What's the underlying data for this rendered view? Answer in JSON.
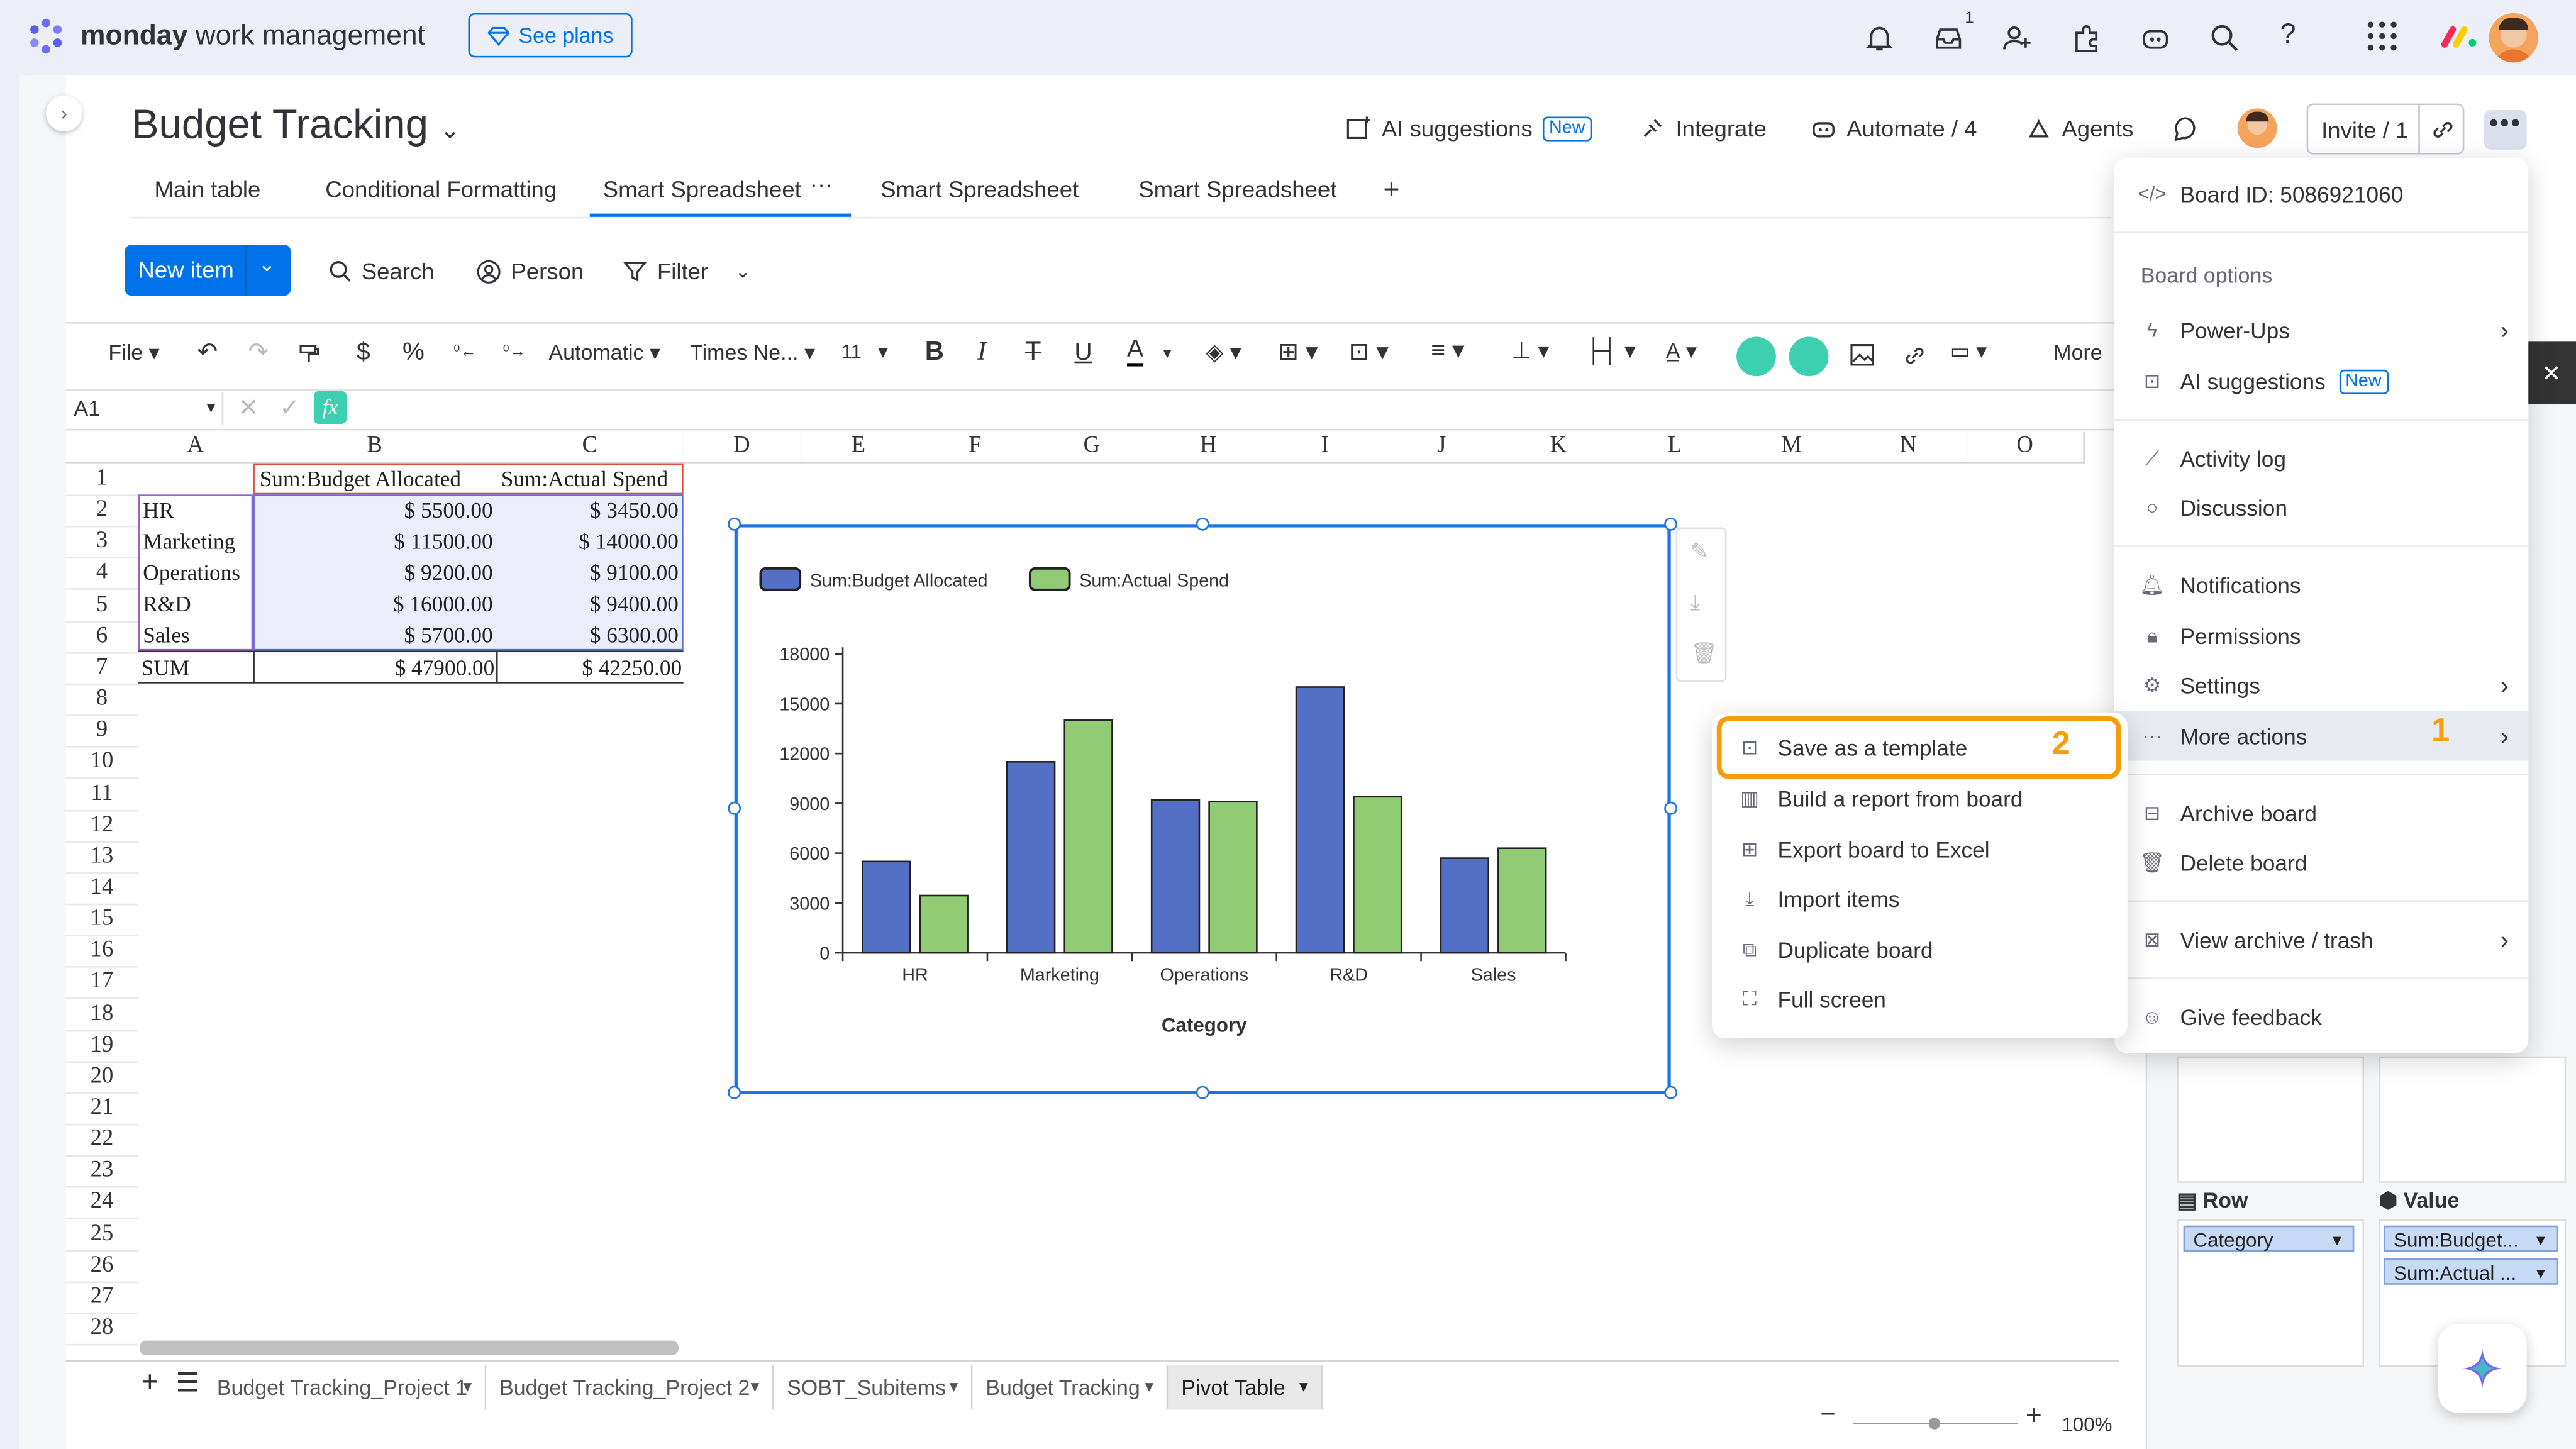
{
  "app": {
    "brand_bold": "monday",
    "brand_rest": " work management",
    "see_plans": "See plans",
    "inbox_count": "1"
  },
  "board": {
    "title": "Budget Tracking",
    "ai_suggestions": "AI suggestions",
    "new_badge": "New",
    "integrate": "Integrate",
    "automate": "Automate / 4",
    "agents": "Agents",
    "invite": "Invite / 1"
  },
  "tabs": [
    "Main table",
    "Conditional Formatting",
    "Smart Spreadsheet",
    "Smart Spreadsheet",
    "Smart Spreadsheet"
  ],
  "tab_add": "+",
  "tab_more": "···",
  "actions": {
    "new_item": "New item",
    "search": "Search",
    "person": "Person",
    "filter": "Filter"
  },
  "toolbar": {
    "file": "File",
    "currency": "$",
    "percent": "%",
    "format": "Automatic",
    "font": "Times Ne...",
    "size": "11",
    "bold": "B",
    "italic": "I",
    "strike": "T",
    "underline": "U",
    "fontcolor": "A",
    "more": "More"
  },
  "formula": {
    "cellref": "A1",
    "fx": "fx"
  },
  "columns": [
    "A",
    "B",
    "C",
    "D",
    "E",
    "F",
    "G",
    "H",
    "I",
    "J",
    "K",
    "L",
    "M",
    "N",
    "O"
  ],
  "rows": [
    "1",
    "2",
    "3",
    "4",
    "5",
    "6",
    "7",
    "8",
    "9",
    "10",
    "11",
    "12",
    "13",
    "14",
    "15",
    "16",
    "17",
    "18",
    "19",
    "20",
    "21",
    "22",
    "23",
    "24",
    "25",
    "26",
    "27",
    "28"
  ],
  "table": {
    "headers": [
      "Sum:Budget Allocated",
      "Sum:Actual Spend"
    ],
    "rows": [
      {
        "cat": "HR",
        "budget": "$ 5500.00",
        "actual": "$ 3450.00"
      },
      {
        "cat": "Marketing",
        "budget": "$ 11500.00",
        "actual": "$ 14000.00"
      },
      {
        "cat": "Operations",
        "budget": "$ 9200.00",
        "actual": "$ 9100.00"
      },
      {
        "cat": "R&D",
        "budget": "$ 16000.00",
        "actual": "$ 9400.00"
      },
      {
        "cat": "Sales",
        "budget": "$ 5700.00",
        "actual": "$ 6300.00"
      }
    ],
    "sum": {
      "label": "SUM",
      "budget": "$ 47900.00",
      "actual": "$ 42250.00"
    }
  },
  "chart_data": {
    "type": "bar",
    "categories": [
      "HR",
      "Marketing",
      "Operations",
      "R&D",
      "Sales"
    ],
    "series": [
      {
        "name": "Sum:Budget Allocated",
        "values": [
          5500,
          11500,
          9200,
          16000,
          5700
        ],
        "color": "#5470c6"
      },
      {
        "name": "Sum:Actual Spend",
        "values": [
          3450,
          14000,
          9100,
          9400,
          6300
        ],
        "color": "#91cc75"
      }
    ],
    "xlabel": "Category",
    "ylabel": "",
    "ylim": [
      0,
      18000
    ],
    "yticks": [
      0,
      3000,
      6000,
      9000,
      12000,
      15000,
      18000
    ],
    "legend": "top-left"
  },
  "sheet_tabs": [
    "Budget Tracking_Project 1",
    "Budget Tracking_Project 2",
    "SOBT_Subitems",
    "Budget Tracking",
    "Pivot Table"
  ],
  "zoom": "100%",
  "board_menu": {
    "board_id": "Board ID: 5086921060",
    "section": "Board options",
    "items": [
      "Power-Ups",
      "AI suggestions",
      "Activity log",
      "Discussion",
      "Notifications",
      "Permissions",
      "Settings",
      "More actions",
      "Archive board",
      "Delete board",
      "View archive / trash",
      "Give feedback"
    ],
    "ai_new": "New",
    "step": "1"
  },
  "more_actions_menu": {
    "items": [
      "Save as a template",
      "Build a report from board",
      "Export board to Excel",
      "Import items",
      "Duplicate board",
      "Full screen"
    ],
    "step": "2"
  },
  "pivot": {
    "row_label": "Row",
    "value_label": "Value",
    "row_field": "Category",
    "value_fields": [
      "Sum:Budget...",
      "Sum:Actual ..."
    ]
  },
  "colors": {
    "accent": "#0073ea",
    "highlight": "#f59e0b"
  }
}
